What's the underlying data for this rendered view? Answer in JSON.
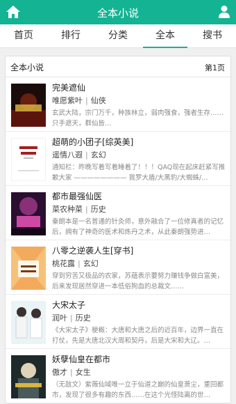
{
  "header": {
    "title": "全本小说",
    "home_icon": "home-icon",
    "user_icon": "user-icon",
    "color": "#14b394"
  },
  "nav": {
    "tabs": [
      "首页",
      "排行",
      "分类",
      "全本",
      "搜书"
    ],
    "active_index": 3
  },
  "panel": {
    "title": "全本小说",
    "page": "第1页"
  },
  "books": [
    {
      "title": "完美遮仙",
      "author": "唯愿紫叶",
      "category": "仙侠",
      "desc": "玄武大陆，宗门万千，种族林立，弱肉强食，强者生存……只手遮天，群仙皆…"
    },
    {
      "title": "超萌的小团子[综英美]",
      "author": "遥情八遐",
      "category": "玄幻",
      "desc": "通知栏：昨晚写着写着睡着了！！！QAQ现在起床赶紧写推歉大家 ———————— 我罗大盾/大黑豹/大蜘蛛/…"
    },
    {
      "title": "都市最强仙医",
      "author": "菜农种菜",
      "category": "历史",
      "desc": "秦朗本是一名普通的针灸师，意外融合了一位修真者的记忆后，拥有了神奇的医术和炼丹之术，从此秦朗强势进…"
    },
    {
      "title": "八零之逆袭人生[穿书]",
      "author": "桃花露",
      "category": "玄幻",
      "desc": "穿到穷苦又极品的农家，苏蕴表示要努力赚钱争做白富美，后来发现居然穿进一本低俗狗血的总裁文……"
    },
    {
      "title": "大宋太子",
      "author": "润叶",
      "category": "历史",
      "desc": "《大宋太子》梗概：大唐和大唐之后的近百年，边界一直在打仗，先是大唐北汉大周和契丹，后是大宋和大辽。…"
    },
    {
      "title": "妖孽仙皇在都市",
      "author": "傲才",
      "category": "女生",
      "desc": "（无敌文）紫薇仙域唯一立于仙道之巅的仙皇萧尘，重回都市，发现了很多有趣的东西……在这个光怪陆离的世…"
    }
  ]
}
